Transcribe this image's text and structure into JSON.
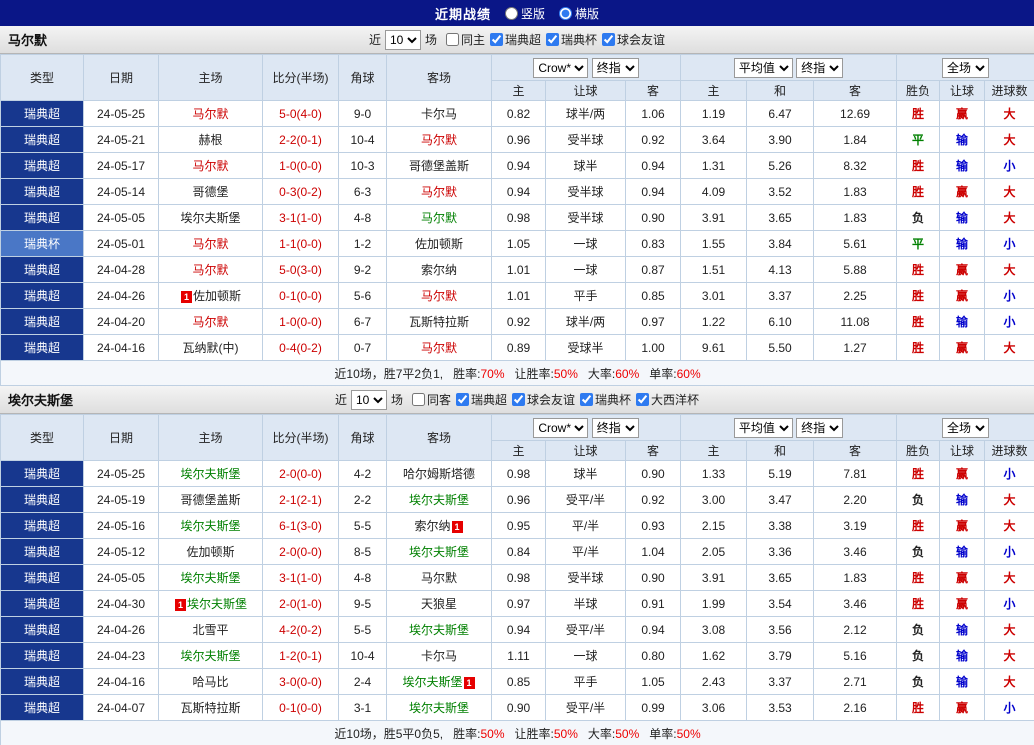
{
  "topbar": {
    "title": "近期战绩",
    "layout_options": [
      {
        "label": "竖版",
        "checked": false
      },
      {
        "label": "横版",
        "checked": true
      }
    ]
  },
  "colors": {
    "topbar_bg": "#0a1687",
    "league_badge": {
      "瑞典超": "#17378e",
      "瑞典杯": "#4a77c6"
    },
    "team": {
      "red": "#cc0000",
      "green": "#008000",
      "black": "#222222"
    },
    "values": {
      "胜": "#cc0000",
      "平": "#008000",
      "负": "#222222",
      "赢": "#cc0000",
      "输": "#0000cc",
      "大": "#cc0000",
      "小": "#0000cc"
    },
    "score": "#cc0000",
    "stat_value": "#ee0000"
  },
  "table_header": {
    "static_cols": [
      "类型",
      "日期",
      "主场",
      "比分(半场)",
      "角球",
      "客场"
    ],
    "odds_group": {
      "selects": [
        "Crow*",
        "终指"
      ],
      "subcols": [
        "主",
        "让球",
        "客"
      ]
    },
    "mean_group": {
      "selects": [
        "平均值",
        "终指"
      ],
      "subcols": [
        "主",
        "和",
        "客"
      ]
    },
    "result_group": {
      "selects": [
        "全场"
      ],
      "subcols": [
        "胜负",
        "让球",
        "进球数"
      ]
    }
  },
  "sections": [
    {
      "team": "马尔默",
      "filter": {
        "near_label": "近",
        "count": "10",
        "games_label": "场",
        "checkboxes": [
          {
            "label": "同主",
            "checked": false
          },
          {
            "label": "瑞典超",
            "checked": true
          },
          {
            "label": "瑞典杯",
            "checked": true
          },
          {
            "label": "球会友谊",
            "checked": true
          }
        ]
      },
      "rows": [
        {
          "league": "瑞典超",
          "date": "24-05-25",
          "home": "马尔默",
          "home_color": "red",
          "score": "5-0(4-0)",
          "corner": "9-0",
          "away": "卡尔马",
          "away_color": "black",
          "odds": [
            "0.82",
            "球半/两",
            "1.06"
          ],
          "mean": [
            "1.19",
            "6.47",
            "12.69"
          ],
          "result": [
            "胜",
            "赢",
            "大"
          ]
        },
        {
          "league": "瑞典超",
          "date": "24-05-21",
          "home": "赫根",
          "home_color": "black",
          "score": "2-2(0-1)",
          "corner": "10-4",
          "away": "马尔默",
          "away_color": "red",
          "odds": [
            "0.96",
            "受半球",
            "0.92"
          ],
          "mean": [
            "3.64",
            "3.90",
            "1.84"
          ],
          "result": [
            "平",
            "输",
            "大"
          ]
        },
        {
          "league": "瑞典超",
          "date": "24-05-17",
          "home": "马尔默",
          "home_color": "red",
          "score": "1-0(0-0)",
          "corner": "10-3",
          "away": "哥德堡盖斯",
          "away_color": "black",
          "odds": [
            "0.94",
            "球半",
            "0.94"
          ],
          "mean": [
            "1.31",
            "5.26",
            "8.32"
          ],
          "result": [
            "胜",
            "输",
            "小"
          ]
        },
        {
          "league": "瑞典超",
          "date": "24-05-14",
          "home": "哥德堡",
          "home_color": "black",
          "score": "0-3(0-2)",
          "corner": "6-3",
          "away": "马尔默",
          "away_color": "red",
          "odds": [
            "0.94",
            "受半球",
            "0.94"
          ],
          "mean": [
            "4.09",
            "3.52",
            "1.83"
          ],
          "result": [
            "胜",
            "赢",
            "大"
          ]
        },
        {
          "league": "瑞典超",
          "date": "24-05-05",
          "home": "埃尔夫斯堡",
          "home_color": "black",
          "score": "3-1(1-0)",
          "corner": "4-8",
          "away": "马尔默",
          "away_color": "green",
          "odds": [
            "0.98",
            "受半球",
            "0.90"
          ],
          "mean": [
            "3.91",
            "3.65",
            "1.83"
          ],
          "result": [
            "负",
            "输",
            "大"
          ]
        },
        {
          "league": "瑞典杯",
          "date": "24-05-01",
          "home": "马尔默",
          "home_color": "red",
          "score": "1-1(0-0)",
          "corner": "1-2",
          "away": "佐加顿斯",
          "away_color": "black",
          "odds": [
            "1.05",
            "一球",
            "0.83"
          ],
          "mean": [
            "1.55",
            "3.84",
            "5.61"
          ],
          "result": [
            "平",
            "输",
            "小"
          ]
        },
        {
          "league": "瑞典超",
          "date": "24-04-28",
          "home": "马尔默",
          "home_color": "red",
          "score": "5-0(3-0)",
          "corner": "9-2",
          "away": "索尔纳",
          "away_color": "black",
          "odds": [
            "1.01",
            "一球",
            "0.87"
          ],
          "mean": [
            "1.51",
            "4.13",
            "5.88"
          ],
          "result": [
            "胜",
            "赢",
            "大"
          ]
        },
        {
          "league": "瑞典超",
          "date": "24-04-26",
          "home": "佐加顿斯",
          "home_color": "black",
          "home_badge": "1",
          "score": "0-1(0-0)",
          "corner": "5-6",
          "away": "马尔默",
          "away_color": "red",
          "odds": [
            "1.01",
            "平手",
            "0.85"
          ],
          "mean": [
            "3.01",
            "3.37",
            "2.25"
          ],
          "result": [
            "胜",
            "赢",
            "小"
          ]
        },
        {
          "league": "瑞典超",
          "date": "24-04-20",
          "home": "马尔默",
          "home_color": "red",
          "score": "1-0(0-0)",
          "corner": "6-7",
          "away": "瓦斯特拉斯",
          "away_color": "black",
          "odds": [
            "0.92",
            "球半/两",
            "0.97"
          ],
          "mean": [
            "1.22",
            "6.10",
            "11.08"
          ],
          "result": [
            "胜",
            "输",
            "小"
          ]
        },
        {
          "league": "瑞典超",
          "date": "24-04-16",
          "home": "瓦纳默(中)",
          "home_color": "black",
          "score": "0-4(0-2)",
          "corner": "0-7",
          "away": "马尔默",
          "away_color": "red",
          "odds": [
            "0.89",
            "受球半",
            "1.00"
          ],
          "mean": [
            "9.61",
            "5.50",
            "1.27"
          ],
          "result": [
            "胜",
            "赢",
            "大"
          ]
        }
      ],
      "summary": {
        "record": "近10场，胜7平2负1,",
        "stats": [
          {
            "label": "胜率:",
            "value": "70%"
          },
          {
            "label": "让胜率:",
            "value": "50%"
          },
          {
            "label": "大率:",
            "value": "60%"
          },
          {
            "label": "单率:",
            "value": "60%"
          }
        ]
      }
    },
    {
      "team": "埃尔夫斯堡",
      "filter": {
        "near_label": "近",
        "count": "10",
        "games_label": "场",
        "checkboxes": [
          {
            "label": "同客",
            "checked": false
          },
          {
            "label": "瑞典超",
            "checked": true
          },
          {
            "label": "球会友谊",
            "checked": true
          },
          {
            "label": "瑞典杯",
            "checked": true
          },
          {
            "label": "大西洋杯",
            "checked": true
          }
        ]
      },
      "rows": [
        {
          "league": "瑞典超",
          "date": "24-05-25",
          "home": "埃尔夫斯堡",
          "home_color": "green",
          "score": "2-0(0-0)",
          "corner": "4-2",
          "away": "哈尔姆斯塔德",
          "away_color": "black",
          "odds": [
            "0.98",
            "球半",
            "0.90"
          ],
          "mean": [
            "1.33",
            "5.19",
            "7.81"
          ],
          "result": [
            "胜",
            "赢",
            "小"
          ]
        },
        {
          "league": "瑞典超",
          "date": "24-05-19",
          "home": "哥德堡盖斯",
          "home_color": "black",
          "score": "2-1(2-1)",
          "corner": "2-2",
          "away": "埃尔夫斯堡",
          "away_color": "green",
          "odds": [
            "0.96",
            "受平/半",
            "0.92"
          ],
          "mean": [
            "3.00",
            "3.47",
            "2.20"
          ],
          "result": [
            "负",
            "输",
            "大"
          ]
        },
        {
          "league": "瑞典超",
          "date": "24-05-16",
          "home": "埃尔夫斯堡",
          "home_color": "green",
          "score": "6-1(3-0)",
          "corner": "5-5",
          "away": "索尔纳",
          "away_color": "black",
          "away_badge": "1",
          "odds": [
            "0.95",
            "平/半",
            "0.93"
          ],
          "mean": [
            "2.15",
            "3.38",
            "3.19"
          ],
          "result": [
            "胜",
            "赢",
            "大"
          ]
        },
        {
          "league": "瑞典超",
          "date": "24-05-12",
          "home": "佐加顿斯",
          "home_color": "black",
          "score": "2-0(0-0)",
          "corner": "8-5",
          "away": "埃尔夫斯堡",
          "away_color": "green",
          "odds": [
            "0.84",
            "平/半",
            "1.04"
          ],
          "mean": [
            "2.05",
            "3.36",
            "3.46"
          ],
          "result": [
            "负",
            "输",
            "小"
          ]
        },
        {
          "league": "瑞典超",
          "date": "24-05-05",
          "home": "埃尔夫斯堡",
          "home_color": "green",
          "score": "3-1(1-0)",
          "corner": "4-8",
          "away": "马尔默",
          "away_color": "black",
          "odds": [
            "0.98",
            "受半球",
            "0.90"
          ],
          "mean": [
            "3.91",
            "3.65",
            "1.83"
          ],
          "result": [
            "胜",
            "赢",
            "大"
          ]
        },
        {
          "league": "瑞典超",
          "date": "24-04-30",
          "home": "埃尔夫斯堡",
          "home_color": "green",
          "home_badge": "1",
          "score": "2-0(1-0)",
          "corner": "9-5",
          "away": "天狼星",
          "away_color": "black",
          "odds": [
            "0.97",
            "半球",
            "0.91"
          ],
          "mean": [
            "1.99",
            "3.54",
            "3.46"
          ],
          "result": [
            "胜",
            "赢",
            "小"
          ]
        },
        {
          "league": "瑞典超",
          "date": "24-04-26",
          "home": "北雪平",
          "home_color": "black",
          "score": "4-2(0-2)",
          "corner": "5-5",
          "away": "埃尔夫斯堡",
          "away_color": "green",
          "odds": [
            "0.94",
            "受平/半",
            "0.94"
          ],
          "mean": [
            "3.08",
            "3.56",
            "2.12"
          ],
          "result": [
            "负",
            "输",
            "大"
          ]
        },
        {
          "league": "瑞典超",
          "date": "24-04-23",
          "home": "埃尔夫斯堡",
          "home_color": "green",
          "score": "1-2(0-1)",
          "corner": "10-4",
          "away": "卡尔马",
          "away_color": "black",
          "odds": [
            "1.11",
            "一球",
            "0.80"
          ],
          "mean": [
            "1.62",
            "3.79",
            "5.16"
          ],
          "result": [
            "负",
            "输",
            "大"
          ]
        },
        {
          "league": "瑞典超",
          "date": "24-04-16",
          "home": "哈马比",
          "home_color": "black",
          "score": "3-0(0-0)",
          "corner": "2-4",
          "away": "埃尔夫斯堡",
          "away_color": "green",
          "away_badge": "1",
          "odds": [
            "0.85",
            "平手",
            "1.05"
          ],
          "mean": [
            "2.43",
            "3.37",
            "2.71"
          ],
          "result": [
            "负",
            "输",
            "大"
          ]
        },
        {
          "league": "瑞典超",
          "date": "24-04-07",
          "home": "瓦斯特拉斯",
          "home_color": "black",
          "score": "0-1(0-0)",
          "corner": "3-1",
          "away": "埃尔夫斯堡",
          "away_color": "green",
          "odds": [
            "0.90",
            "受平/半",
            "0.99"
          ],
          "mean": [
            "3.06",
            "3.53",
            "2.16"
          ],
          "result": [
            "胜",
            "赢",
            "小"
          ]
        }
      ],
      "summary": {
        "record": "近10场，胜5平0负5,",
        "stats": [
          {
            "label": "胜率:",
            "value": "50%"
          },
          {
            "label": "让胜率:",
            "value": "50%"
          },
          {
            "label": "大率:",
            "value": "50%"
          },
          {
            "label": "单率:",
            "value": "50%"
          }
        ]
      }
    }
  ]
}
